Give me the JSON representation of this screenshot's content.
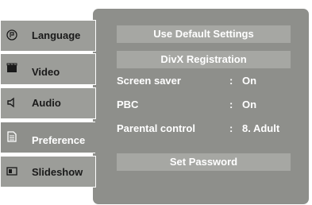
{
  "menu": {
    "tabs": [
      {
        "label": "Language",
        "icon": "disc-icon"
      },
      {
        "label": "Video",
        "icon": "video-icon"
      },
      {
        "label": "Audio",
        "icon": "speaker-icon"
      },
      {
        "label": "Preference",
        "icon": "document-icon"
      },
      {
        "label": "Slideshow",
        "icon": "picture-icon"
      }
    ],
    "active_tab": "Preference"
  },
  "panel": {
    "use_default_label": "Use Default Settings",
    "divx_label": "DivX Registration",
    "settings": [
      {
        "label": "Screen saver",
        "colon": ":",
        "value": "On"
      },
      {
        "label": "PBC",
        "colon": ":",
        "value": "On"
      },
      {
        "label": "Parental control",
        "colon": ":",
        "value": "8. Adult"
      }
    ],
    "set_password_label": "Set Password"
  },
  "colors": {
    "panel": "#8e8f8b",
    "button": "#a6a7a3",
    "tab": "#9c9d99",
    "text_light": "#ffffff",
    "text_dark": "#1a1a1a"
  }
}
